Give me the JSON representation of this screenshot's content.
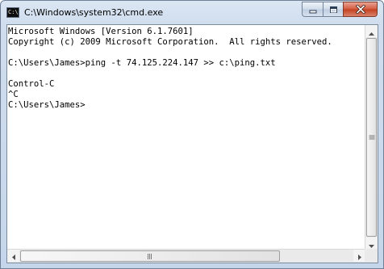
{
  "window": {
    "title": "C:\\Windows\\system32\\cmd.exe",
    "icon": "cmd-console-icon",
    "icon_glyph": "C:\\"
  },
  "caption_buttons": {
    "minimize": "minimize-icon",
    "maximize": "maximize-icon",
    "close": "close-icon"
  },
  "console": {
    "lines": [
      "Microsoft Windows [Version 6.1.7601]",
      "Copyright (c) 2009 Microsoft Corporation.  All rights reserved.",
      "",
      "C:\\Users\\James>ping -t 74.125.224.147 >> c:\\ping.txt",
      "",
      "Control-C",
      "^C",
      "C:\\Users\\James>"
    ],
    "text_color": "#000000",
    "background_color": "#ffffff"
  },
  "scrollbars": {
    "vertical": {
      "up": "arrow-up-icon",
      "down": "arrow-down-icon"
    },
    "horizontal": {
      "left": "arrow-left-icon",
      "right": "arrow-right-icon"
    }
  }
}
